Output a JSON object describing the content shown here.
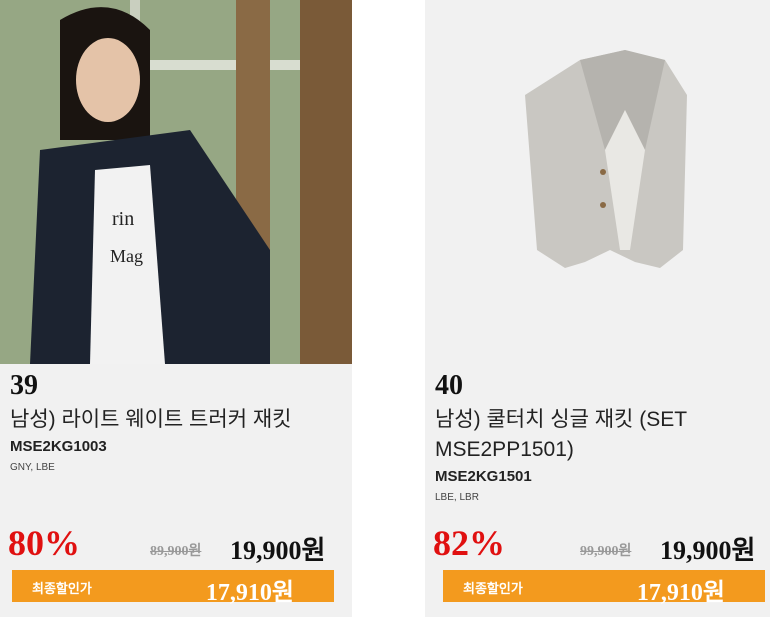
{
  "products": [
    {
      "rank": "39",
      "name": "남성) 라이트 웨이트 트러커 재킷",
      "code": "MSE2KG1003",
      "colors": "GNY, LBE",
      "discount": "80%",
      "original_price": "89,900원",
      "sale_price": "19,900원",
      "final_label": "최종할인가",
      "final_price": "17,910원"
    },
    {
      "rank": "40",
      "name": "남성) 쿨터치 싱글 재킷 (SET MSE2PP1501)",
      "code": "MSE2KG1501",
      "colors": "LBE, LBR",
      "discount": "82%",
      "original_price": "99,900원",
      "sale_price": "19,900원",
      "final_label": "최종할인가",
      "final_price": "17,910원"
    }
  ],
  "colors": {
    "card_bg": "#f1f1f1",
    "discount": "#e01010",
    "final_bar": "#f39a1e"
  }
}
